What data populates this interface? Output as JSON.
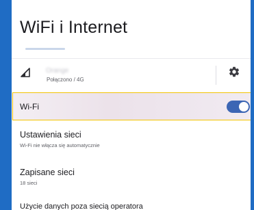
{
  "header": {
    "title": "WiFi i Internet"
  },
  "mobile": {
    "carrier_name": "Orange",
    "status": "Połączono / 4G",
    "signal_icon": "signal-icon",
    "settings_icon": "gear-icon"
  },
  "wifi": {
    "label": "Wi-Fi",
    "enabled": true
  },
  "items": [
    {
      "title": "Ustawienia sieci",
      "subtitle": "Wi-Fi nie włącza się automatycznie"
    },
    {
      "title": "Zapisane sieci",
      "subtitle": "18 sieci"
    },
    {
      "title": "Użycie danych poza siecią operatora"
    }
  ],
  "colors": {
    "accent": "#3c66b4",
    "highlight_border": "#f2c200",
    "frame": "#1f6cc4"
  }
}
